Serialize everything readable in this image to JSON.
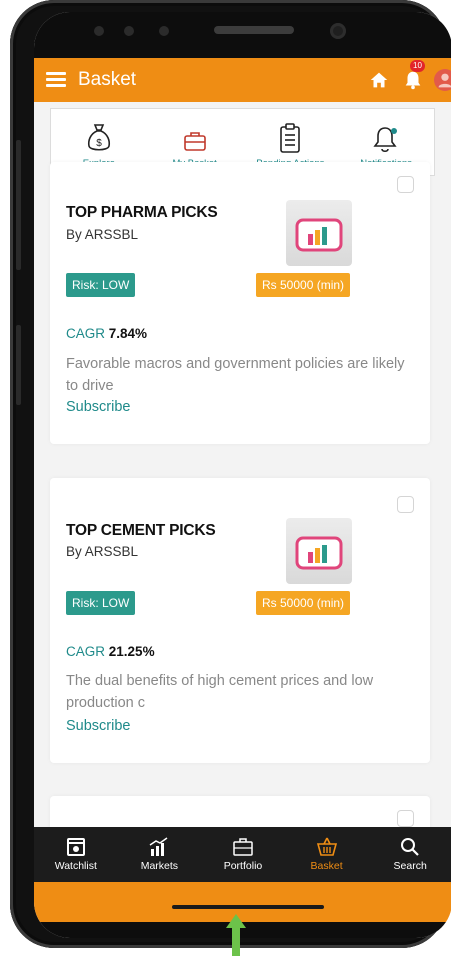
{
  "header": {
    "title": "Basket",
    "badge_count": "10",
    "color": "#ef8d14"
  },
  "quickmenu": [
    {
      "label": "Explore",
      "icon": "money-bag-icon"
    },
    {
      "label": "My Basket",
      "icon": "briefcase-icon"
    },
    {
      "label": "Pending Actions",
      "icon": "clipboard-icon"
    },
    {
      "label": "Notifications",
      "icon": "bell-icon"
    }
  ],
  "cards": [
    {
      "title": "TOP PHARMA PICKS",
      "by": "By ARSSBL",
      "risk": "Risk: LOW",
      "min_amount": "Rs 50000 (min)",
      "cagr_label": "CAGR",
      "cagr_value": "7.84%",
      "description": "Favorable macros and government policies are likely to drive",
      "subscribe": "Subscribe"
    },
    {
      "title": "TOP CEMENT PICKS",
      "by": "By ARSSBL",
      "risk": "Risk: LOW",
      "min_amount": "Rs 50000 (min)",
      "cagr_label": "CAGR",
      "cagr_value": "21.25%",
      "description": "The dual benefits of high cement prices and low production c",
      "subscribe": "Subscribe"
    }
  ],
  "tabs": [
    {
      "label": "Watchlist",
      "icon": "watchlist-icon",
      "active": false
    },
    {
      "label": "Markets",
      "icon": "markets-icon",
      "active": false
    },
    {
      "label": "Portfolio",
      "icon": "portfolio-icon",
      "active": false
    },
    {
      "label": "Basket",
      "icon": "basket-icon",
      "active": true
    },
    {
      "label": "Search",
      "icon": "search-icon",
      "active": false
    }
  ],
  "colors": {
    "accent": "#ef8d14",
    "teal": "#1f8a8a",
    "risk_badge": "#2c9a8c",
    "amount_badge": "#f5a623"
  }
}
